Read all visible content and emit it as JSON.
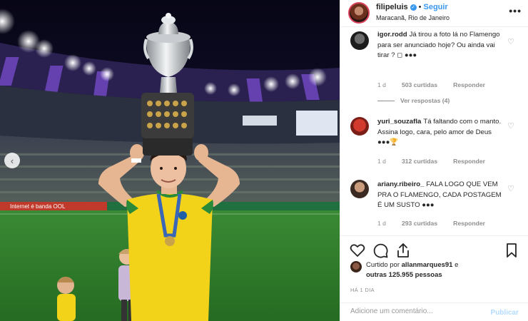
{
  "header": {
    "username": "filipeluis",
    "separator": "•",
    "follow_label": "Seguir",
    "location": "Maracanã, Rio de Janeiro",
    "more_icon": "more-horizontal-icon"
  },
  "photo": {
    "banner_text": "Internet é banda  OOL",
    "prev_icon": "chevron-left-icon"
  },
  "comments": [
    {
      "username": "igor.rodd",
      "text": "Já tirou a foto lá no Flamengo para ser anunciado hoje? Ou ainda vai tirar ? ◻ ●●●",
      "time": "1 d",
      "likes": "503 curtidas",
      "reply_label": "Responder",
      "view_replies": "Ver respostas (4)"
    },
    {
      "username": "yuri_souzafla",
      "text": "Tá faltando com o manto. Assina logo, cara, pelo amor de Deus ●●●🏆",
      "time": "1 d",
      "likes": "312 curtidas",
      "reply_label": "Responder"
    },
    {
      "username": "ariany.ribeiro_",
      "text": "FALA LOGO QUE VEM PRA O FLAMENGO, CADA POSTAGEM É UM SUSTO ●●●",
      "time": "1 d",
      "likes": "293 curtidas",
      "reply_label": "Responder"
    }
  ],
  "actions": {
    "like_icon": "heart-icon",
    "comment_icon": "comment-icon",
    "share_icon": "share-icon",
    "save_icon": "bookmark-icon"
  },
  "likes": {
    "prefix": "Curtido por ",
    "user": "allanmarques91",
    "suffix": " e",
    "others": "outras 125.955 pessoas"
  },
  "time_ago": "HÁ 1 DIA",
  "add_comment": {
    "placeholder": "Adicione um comentário...",
    "publish_label": "Publicar"
  },
  "colors": {
    "accent": "#3897f0",
    "jersey": "#f2d31a",
    "pitch": "#2f7a2c",
    "sky": "#0b0a22"
  }
}
